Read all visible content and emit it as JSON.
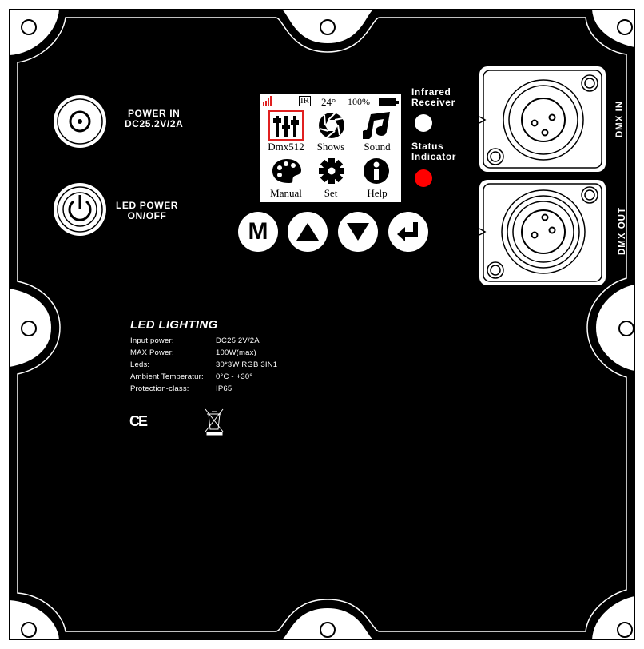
{
  "power_in": {
    "line1": "POWER IN",
    "line2": "DC25.2V/2A"
  },
  "led_power": {
    "line1": "LED POWER",
    "line2": "ON/OFF"
  },
  "infrared": {
    "line1": "Infrared",
    "line2": "Receiver"
  },
  "status": {
    "line1": "Status",
    "line2": "Indicator"
  },
  "dmx_in": "DMX IN",
  "dmx_out": "DMX OUT",
  "lcd": {
    "ir": "IR",
    "temp": "24°",
    "battery": "100%",
    "menu": [
      "Dmx512",
      "Shows",
      "Sound",
      "Manual",
      "Set",
      "Help"
    ],
    "icons": [
      "sliders-icon",
      "aperture-icon",
      "music-note-icon",
      "palette-icon",
      "gear-icon",
      "info-icon"
    ]
  },
  "buttons": [
    {
      "name": "menu-button",
      "icon": "M"
    },
    {
      "name": "up-button",
      "icon": "up-arrow-icon"
    },
    {
      "name": "down-button",
      "icon": "down-arrow-icon"
    },
    {
      "name": "enter-button",
      "icon": "enter-icon"
    }
  ],
  "spec": {
    "title": "LED LIGHTING",
    "rows": [
      {
        "label": "Input power:",
        "value": "DC25.2V/2A"
      },
      {
        "label": "MAX Power:",
        "value": "100W(max)"
      },
      {
        "label": "Leds:",
        "value": "30*3W RGB 3IN1"
      },
      {
        "label": "Ambient Temperatur:",
        "value": "0°C - +30°"
      },
      {
        "label": "Protection-class:",
        "value": "IP65"
      }
    ],
    "ce": "CE"
  },
  "colors": {
    "panel": "#000000",
    "status_led": "#ff0000",
    "infrared": "#ffffff",
    "highlight": "#e02020",
    "signal": "#e02020"
  }
}
